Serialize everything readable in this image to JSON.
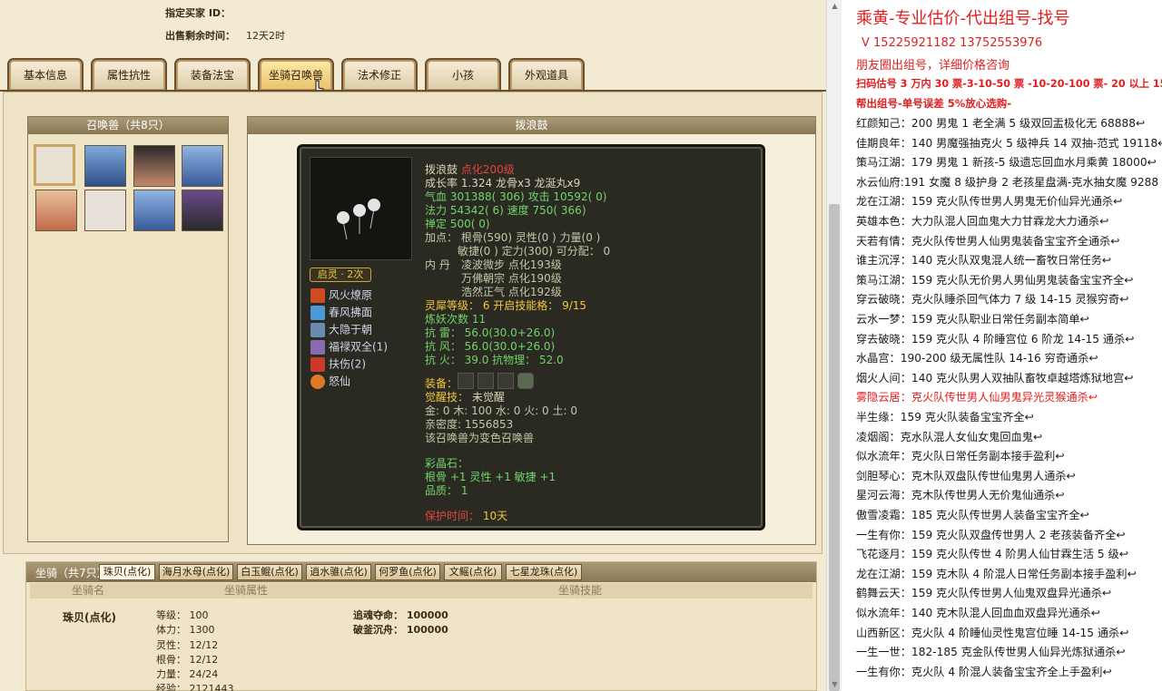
{
  "header": {
    "buyer_label": "指定买家 ID：",
    "remaining_label": "出售剩余时间：",
    "remaining_value": "12天2时"
  },
  "tabs": [
    "基本信息",
    "属性抗性",
    "装备法宝",
    "坐骑召唤兽",
    "法术修正",
    "小孩",
    "外观道具"
  ],
  "pet_list": {
    "title": "召唤兽（共8只）"
  },
  "detail": {
    "panel_title": "拨浪鼓",
    "name": "拨浪鼓",
    "name_tag": "点化200级",
    "growth": "成长率 1.324 龙骨x3 龙涎丸x9",
    "hp_label": "气血",
    "hp": "301388( 306)",
    "atk_label": "攻击",
    "atk": "10592( 0)",
    "mp_label": "法力",
    "mp": "54342( 6)",
    "spd_label": "速度",
    "spd": "750( 366)",
    "def_label": "禅定",
    "def": "500( 0)",
    "points1": "加点：  根骨(590) 灵性(0 ) 力量(0 )",
    "points2": "敏捷(0 ) 定力(300) 可分配：  0",
    "neidan_label": "内    丹",
    "neidan1": "凌波微步 点化193级",
    "neidan2": "万佛朝宗 点化190级",
    "neidan3": "浩然正气 点化192级",
    "lingxi": "灵犀等级： 6 开启技能格： 9/15",
    "lianyao": "炼妖次数 11",
    "res1": "抗   雷： 56.0(30.0+26.0)",
    "res2": "抗   风： 56.0(30.0+26.0)",
    "res3": "抗   火： 39.0 抗物理： 52.0",
    "qiling": "启灵 · 2次",
    "skills": [
      "风火燎原",
      "春风拂面",
      "大隐于朝",
      "福禄双全(1)",
      "扶伤(2)",
      "怒仙"
    ],
    "equip_label": "装备：",
    "awaken_label": "觉醒技：",
    "awaken_value": "未觉醒",
    "elements": "金: 0 木: 100 水: 0 火: 0 土: 0",
    "intimacy": "亲密度: 1556853",
    "note": "该召唤兽为变色召唤兽",
    "gem_label": "彩晶石：",
    "gem_stats": "根骨 +1 灵性 +1 敏捷 +1",
    "quality": "品质： 1",
    "expire_label": "保护时间：",
    "expire_value": "10天"
  },
  "mounts": {
    "title": "坐骑（共7只）",
    "tabs": [
      "珠贝(点化)",
      "海月水母(点化)",
      "白玉鲲(点化)",
      "逍水骓(点化)",
      "何罗鱼(点化)",
      "文鳐(点化)",
      "七星龙珠(点化)"
    ],
    "col_name": "坐骑名",
    "col_attr": "坐骑属性",
    "col_skill": "坐骑技能",
    "name": "珠贝(点化)",
    "attrs": [
      "等级：  100",
      "体力：  1300",
      "灵性：  12/12",
      "根骨：  12/12",
      "力量：  24/24",
      "经验：  2121443"
    ],
    "skills": [
      "追魂夺命： 100000",
      "破釜沉舟： 100000"
    ]
  },
  "right": {
    "title": "乘黄-专业估价-代出组号-找号",
    "phone": "V 15225921182   13752553976",
    "line3": "朋友圈出组号，详细价格咨询",
    "line4": "扫码估号 3 万内 30 票-3-10-50 票  -10-20-100 票- 20 以上 150",
    "line5": "帮出组号-单号误差 5%放心选购-",
    "items": [
      "红颜知己：200 男鬼 1 老全满 5 级双回盂极化无 68888↩",
      "佳期良年：140 男魔强抽克火 5 级神兵 14 双抽-范式 19118↩",
      "策马江湖：179 男鬼 1 新孩-5 级遗忘回血水月乘黄 18000↩",
      "水云仙府:191 女魔 8 级护身 2 老孩星盘满-克水抽女魔 9288",
      "龙在江湖：159 克火队传世男人男鬼无价仙异光通杀↩",
      "英雄本色：大力队混人回血鬼大力甘霖龙大力通杀↩",
      "天若有情：克火队传世男人仙男鬼装备宝宝齐全通杀↩",
      "谁主沉浮：140 克火队双鬼混人统一畜牧日常任务↩",
      "策马江湖：159 克火队无价男人男仙男鬼装备宝宝齐全↩",
      "穿云破晓：克火队睡杀回气体力 7 级 14-15 灵猴穷奇↩",
      "云水一梦：159 克火队职业日常任务副本简单↩",
      "穿去破晓：159 克火队 4 阶睡宫位 6 阶龙 14-15 通杀↩",
      "水晶宫：190-200 级无属性队 14-16 穷奇通杀↩",
      "烟火人间：140 克火队男人双抽队畜牧卓越塔炼狱地宫↩",
      "雾隐云居：克火队传世男人仙男鬼异光灵猴通杀↩",
      "半生缘：159 克火队装备宝宝齐全↩",
      "凌烟阁：克水队混人女仙女鬼回血鬼↩",
      "似水流年：克火队日常任务副本接手盈利↩",
      "剑胆琴心：克木队双盘队传世仙鬼男人通杀↩",
      "星河云海：克木队传世男人无价鬼仙通杀↩",
      "傲雪凌霜：185 克火队传世男人装备宝宝齐全↩",
      "一生有你：159 克火队双盘传世男人 2 老孩装备齐全↩",
      "飞花逐月：159 克火队传世 4 阶男人仙甘霖生活 5 级↩",
      "龙在江湖：159 克木队 4 阶混人日常任务副本接手盈利↩",
      "鹤舞云天：159 克火队传世男人仙鬼双盘异光通杀↩",
      "似水流年：140 克木队混人回血血双盘异光通杀↩",
      "山西新区：克火队 4 阶睡仙灵性鬼宫位睡 14-15 通杀↩",
      "一生一世：182-185 克金队传世男人仙异光炼狱通杀↩",
      "一生有你：克火队 4 阶混人装备宝宝齐全上手盈利↩"
    ]
  }
}
